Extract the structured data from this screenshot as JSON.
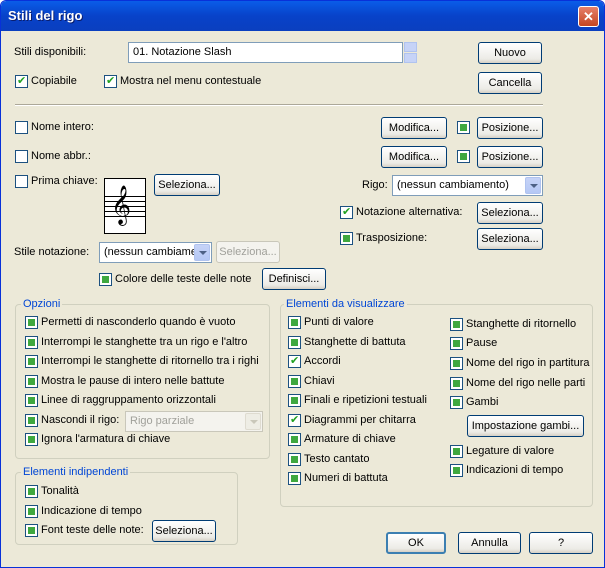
{
  "title": "Stili del rigo",
  "stili_label": "Stili disponibili:",
  "stili_value": "01.  Notazione Slash",
  "buttons": {
    "nuovo": "Nuovo",
    "cancella": "Cancella",
    "modifica": "Modifica...",
    "posizione": "Posizione...",
    "seleziona": "Seleziona...",
    "definisci": "Definisci...",
    "impostazione_gambi": "Impostazione gambi...",
    "ok": "OK",
    "annulla": "Annulla",
    "help": "?"
  },
  "top": {
    "copiabile": "Copiabile",
    "mostra_menu": "Mostra nel menu contestuale"
  },
  "names": {
    "nome_intero": "Nome intero:",
    "nome_abbr": "Nome abbr.:",
    "prima_chiave": "Prima chiave:",
    "clef_glyph": "𝄞"
  },
  "rigo": {
    "label": "Rigo:",
    "value": "(nessun cambiamento)",
    "notazione_alt": "Notazione alternativa:",
    "trasposizione": "Trasposizione:"
  },
  "stile_notazione": {
    "label": "Stile notazione:",
    "value": "(nessun cambiamer",
    "colore": "Colore delle teste delle note"
  },
  "opzioni": {
    "title": "Opzioni",
    "items": [
      "Permetti di nasconderlo quando è vuoto",
      "Interrompi le stanghette tra un rigo e l'altro",
      "Interrompi le stanghette di ritornello tra i righi",
      "Mostra le pause di intero nelle battute",
      "Linee di raggruppamento orizzontali",
      "Nascondi il rigo:",
      "Ignora l'armatura di chiave"
    ],
    "nascondi_value": "Rigo parziale"
  },
  "indipendenti": {
    "title": "Elementi indipendenti",
    "items": [
      "Tonalità",
      "Indicazione di tempo",
      "Font teste delle note:"
    ]
  },
  "visualizzare": {
    "title": "Elementi da visualizzare",
    "left": [
      "Punti di valore",
      "Stanghette di battuta",
      "Accordi",
      "Chiavi",
      "Finali e ripetizioni testuali",
      "Diagrammi per chitarra",
      "Armature di chiave",
      "Testo cantato",
      "Numeri di battuta"
    ],
    "right": [
      "Stanghette di ritornello",
      "Pause",
      "Nome del rigo in partitura",
      "Nome del rigo nelle parti",
      "Gambi",
      "Legature di valore",
      "Indicazioni di tempo"
    ]
  }
}
